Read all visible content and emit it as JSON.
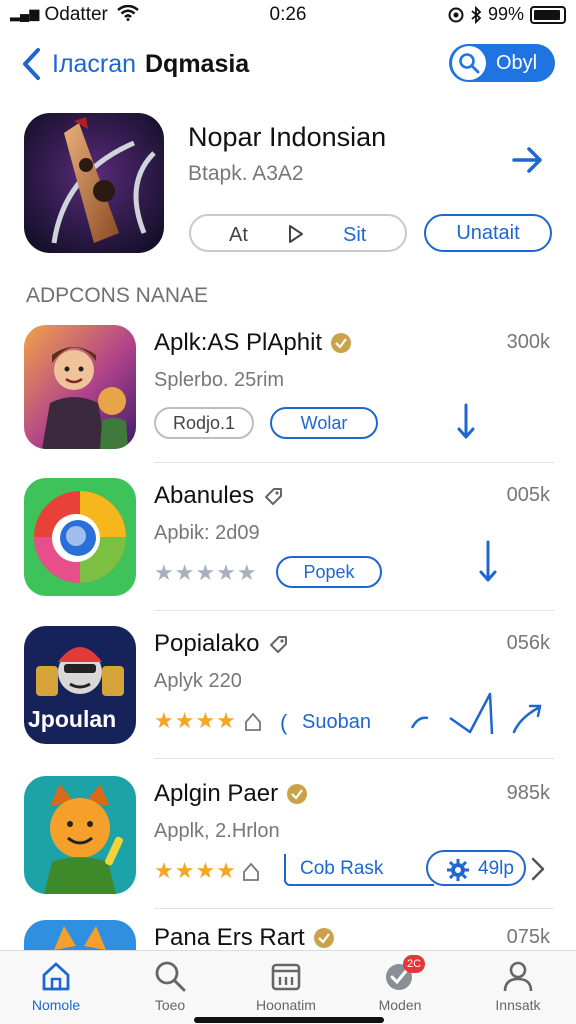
{
  "status": {
    "carrier": "Odatter",
    "time": "0:26",
    "battery": "99%"
  },
  "nav": {
    "back_label": "Iлаcran",
    "title": "Dqmasia",
    "search_label": "Obyl"
  },
  "hero": {
    "title": "Nopar Indonsian",
    "subtitle": "Btapk. A3A2",
    "left_pill_a": "At",
    "left_pill_b": "Sit",
    "right_pill": "Unatait"
  },
  "section": {
    "label": "ADPCONS NANAE"
  },
  "apps": [
    {
      "title": "Aplk:AS PlAphit",
      "subtitle": "Splerbo. 25rim",
      "count": "300k",
      "pill_gray": "Rodjo.1",
      "pill_blue": "Wolar"
    },
    {
      "title": "Abanules",
      "subtitle": "Apbik: 2d09",
      "count": "005k",
      "stars": "★★★★★",
      "pill_blue": "Popek"
    },
    {
      "title": "Popialako",
      "subtitle": "Aplyk 220",
      "count": "056k",
      "stars": "★★★★",
      "pill_blue": "Suoban",
      "icon_text": "Jpoulan"
    },
    {
      "title": "Aplgin Paer",
      "subtitle": "Applk, 2.Hrlon",
      "count": "985k",
      "stars": "★★★★",
      "pill_blue": "Cob Rask",
      "pill_right": "49lp"
    },
    {
      "title": "Pana Ers Rart",
      "count": "075k"
    }
  ],
  "tabs": [
    {
      "label": "Nomole"
    },
    {
      "label": "Toeo"
    },
    {
      "label": "Hoonatim"
    },
    {
      "label": "Moden",
      "badge": "2C"
    },
    {
      "label": "Innsatk"
    }
  ],
  "colors": {
    "accent": "#1e66d0",
    "star": "#f5a623",
    "star_gray": "#a9b0bd"
  }
}
